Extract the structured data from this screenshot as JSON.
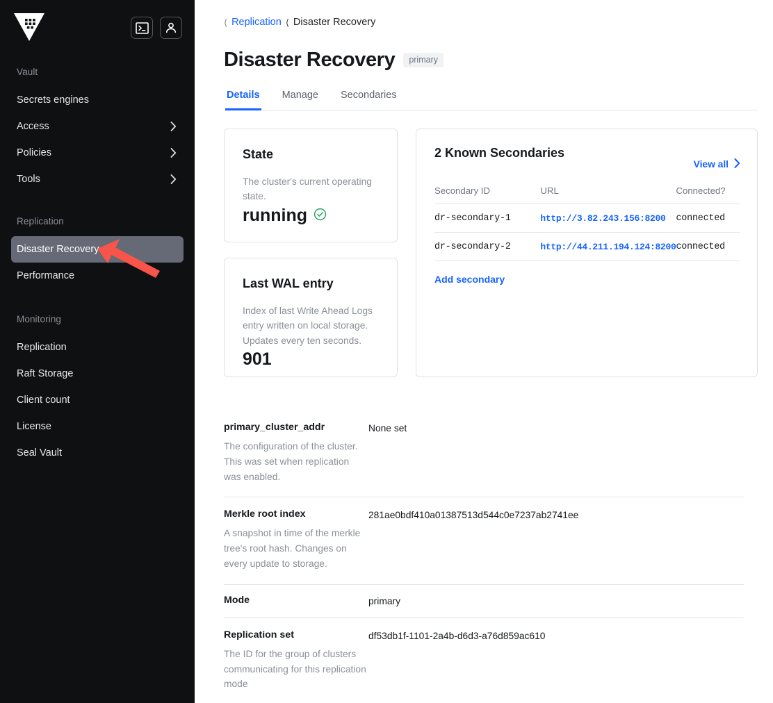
{
  "sidebar": {
    "logo_icon": "vault-logo-icon",
    "actions": [
      {
        "name": "console-toggle-button",
        "icon": "terminal-icon"
      },
      {
        "name": "user-menu-button",
        "icon": "user-icon"
      }
    ],
    "sections": [
      {
        "label": "Vault",
        "items": [
          {
            "label": "Secrets engines",
            "has_chevron": false,
            "active": false
          },
          {
            "label": "Access",
            "has_chevron": true,
            "active": false
          },
          {
            "label": "Policies",
            "has_chevron": true,
            "active": false
          },
          {
            "label": "Tools",
            "has_chevron": true,
            "active": false
          }
        ]
      },
      {
        "label": "Replication",
        "items": [
          {
            "label": "Disaster Recovery",
            "has_chevron": false,
            "active": true
          },
          {
            "label": "Performance",
            "has_chevron": false,
            "active": false
          }
        ]
      },
      {
        "label": "Monitoring",
        "items": [
          {
            "label": "Replication",
            "has_chevron": false,
            "active": false
          },
          {
            "label": "Raft Storage",
            "has_chevron": false,
            "active": false
          },
          {
            "label": "Client count",
            "has_chevron": false,
            "active": false
          },
          {
            "label": "License",
            "has_chevron": false,
            "active": false
          },
          {
            "label": "Seal Vault",
            "has_chevron": false,
            "active": false
          }
        ]
      }
    ]
  },
  "breadcrumb": {
    "parent": "Replication",
    "current": "Disaster Recovery"
  },
  "header": {
    "title": "Disaster Recovery",
    "badge": "primary"
  },
  "tabs": [
    {
      "label": "Details",
      "active": true
    },
    {
      "label": "Manage",
      "active": false
    },
    {
      "label": "Secondaries",
      "active": false
    }
  ],
  "state_card": {
    "title": "State",
    "description": "The cluster's current operating state.",
    "value": "running",
    "status_icon": "check-circle-icon"
  },
  "wal_card": {
    "title": "Last WAL entry",
    "description": "Index of last Write Ahead Logs entry written on local storage. Updates every ten seconds.",
    "value": "901"
  },
  "secondaries_panel": {
    "title": "2 Known Secondaries",
    "view_all_label": "View all",
    "add_secondary_label": "Add secondary",
    "columns": [
      "Secondary ID",
      "URL",
      "Connected?"
    ],
    "rows": [
      {
        "id": "dr-secondary-1",
        "url": "http://3.82.243.156:8200",
        "connected": "connected"
      },
      {
        "id": "dr-secondary-2",
        "url": "http://44.211.194.124:8200",
        "connected": "connected"
      }
    ]
  },
  "details": [
    {
      "label": "primary_cluster_addr",
      "help": "The configuration of the cluster. This was set when replication was enabled.",
      "value": "None set"
    },
    {
      "label": "Merkle root index",
      "help": "A snapshot in time of the merkle tree's root hash. Changes on every update to storage.",
      "value": "281ae0bdf410a01387513d544c0e7237ab2741ee"
    },
    {
      "label": "Mode",
      "help": "",
      "value": "primary"
    },
    {
      "label": "Replication set",
      "help": "The ID for the group of clusters communicating for this replication mode",
      "value": "df53db1f-1101-2a4b-d6d3-a76d859ac610"
    }
  ],
  "colors": {
    "accent_blue": "#1563ff",
    "sidebar_bg": "#0f1011",
    "active_item_bg": "#656a76",
    "status_green": "#22a559",
    "annotation_red": "#f8544a"
  }
}
